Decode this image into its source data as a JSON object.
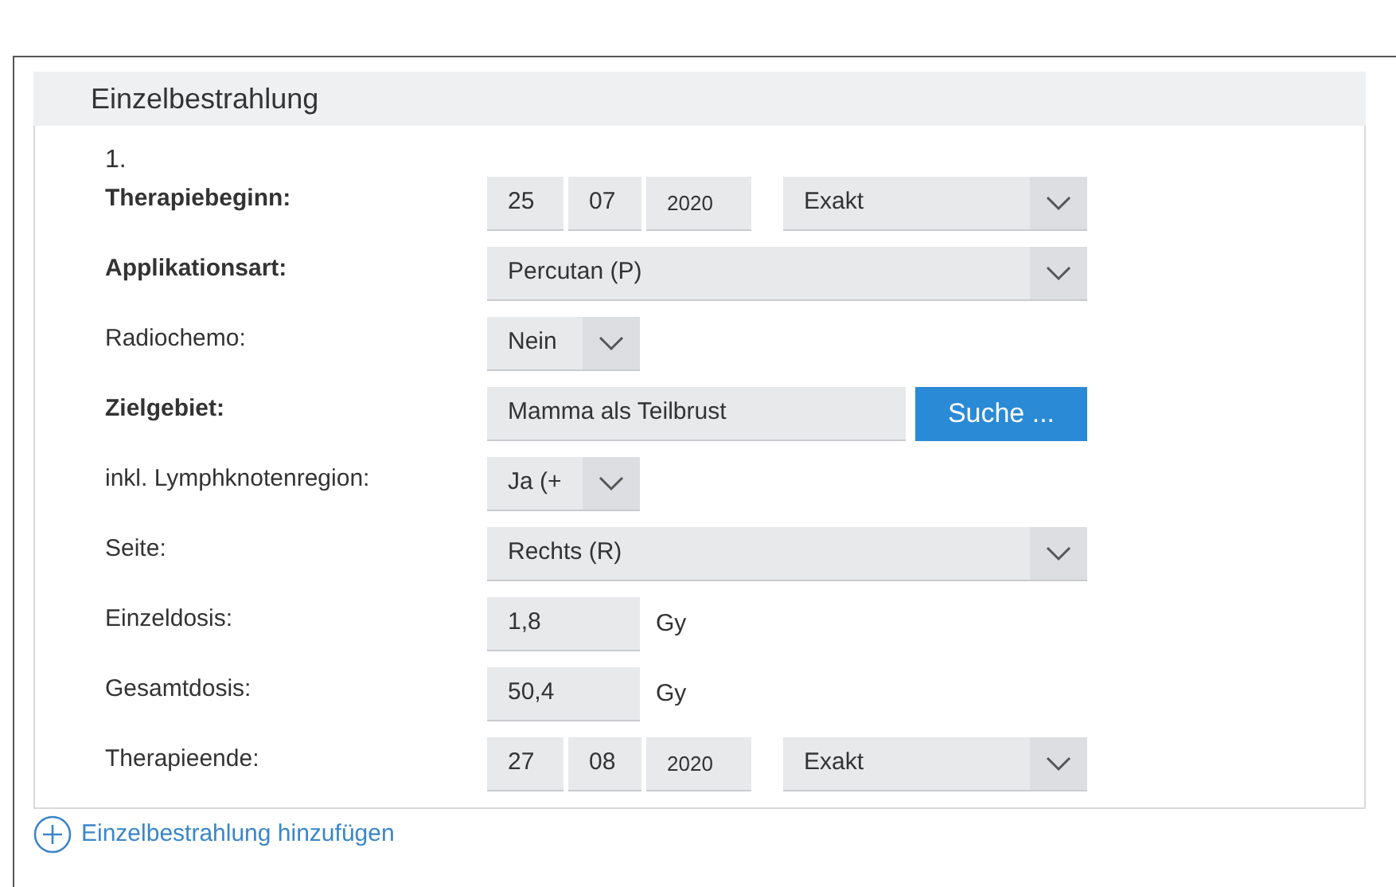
{
  "panel": {
    "title": "Einzelbestrahlung",
    "index": "1.",
    "rows": [
      {
        "label": "Therapiebeginn:",
        "bold": true,
        "kind": "date",
        "day": "25",
        "month": "07",
        "year": "2020",
        "select": "Exakt"
      },
      {
        "label": "Applikationsart:",
        "bold": true,
        "kind": "select",
        "value": "Percutan (P)"
      },
      {
        "label": "Radiochemo:",
        "bold": false,
        "kind": "short_select",
        "value": "Nein"
      },
      {
        "label": "Zielgebiet:",
        "bold": true,
        "kind": "search",
        "value": "Mamma als Teilbrust",
        "button": "Suche ..."
      },
      {
        "label": "inkl. Lymphknotenregion:",
        "bold": false,
        "kind": "short_select",
        "value": "Ja (+"
      },
      {
        "label": "Seite:",
        "bold": false,
        "kind": "select",
        "value": "Rechts (R)"
      },
      {
        "label": "Einzeldosis:",
        "bold": false,
        "kind": "number",
        "value": "1,8",
        "unit": "Gy"
      },
      {
        "label": "Gesamtdosis:",
        "bold": false,
        "kind": "number",
        "value": "50,4",
        "unit": "Gy"
      },
      {
        "label": "Therapieende:",
        "bold": false,
        "kind": "date",
        "day": "27",
        "month": "08",
        "year": "2020",
        "select": "Exakt"
      }
    ]
  },
  "add_link": "Einzelbestrahlung hinzufügen"
}
